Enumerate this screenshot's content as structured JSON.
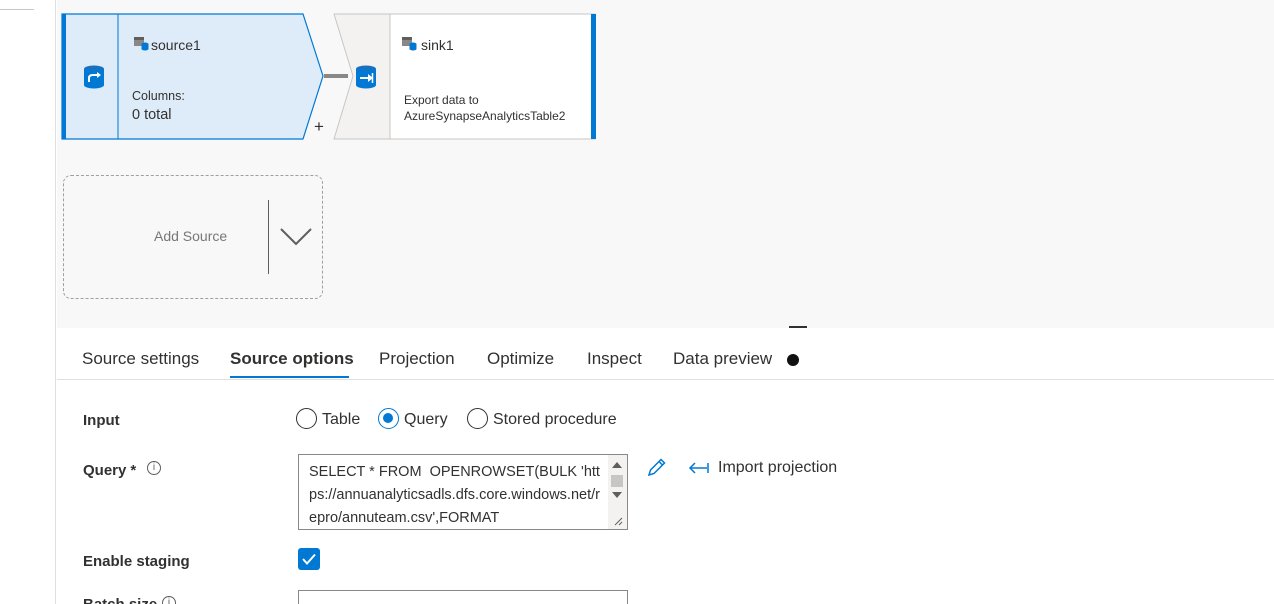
{
  "canvas": {
    "source_node": {
      "name": "source1",
      "columns_label": "Columns:",
      "columns_value": "0 total",
      "add_symbol": "+"
    },
    "sink_node": {
      "name": "sink1",
      "description_line1": "Export data to",
      "description_line2": "AzureSynapseAnalyticsTable2"
    },
    "add_source_label": "Add Source"
  },
  "tabs": [
    {
      "label": "Source settings"
    },
    {
      "label": "Source options"
    },
    {
      "label": "Projection"
    },
    {
      "label": "Optimize"
    },
    {
      "label": "Inspect"
    },
    {
      "label": "Data preview"
    }
  ],
  "form": {
    "input_label": "Input",
    "input_options": [
      "Table",
      "Query",
      "Stored procedure"
    ],
    "input_selected": "Query",
    "query_label": "Query",
    "query_required": "*",
    "query_value": "SELECT * FROM  OPENROWSET(BULK 'https://annuanalyticsadls.dfs.core.windows.net/repro/annuteam.csv',FORMAT",
    "import_projection_label": "Import projection",
    "staging_label": "Enable staging",
    "staging_checked": true,
    "next_label": "Batch size"
  },
  "colors": {
    "accent": "#0078d4",
    "source_fill": "#deecf9",
    "canvas_bg": "#f8f8f8"
  },
  "icons": {
    "source": "source-dataflow-icon",
    "sink": "sink-dataflow-icon",
    "dataset": "dataset-table-icon",
    "info": "info-icon",
    "edit": "pencil-icon",
    "import": "import-arrow-icon"
  }
}
